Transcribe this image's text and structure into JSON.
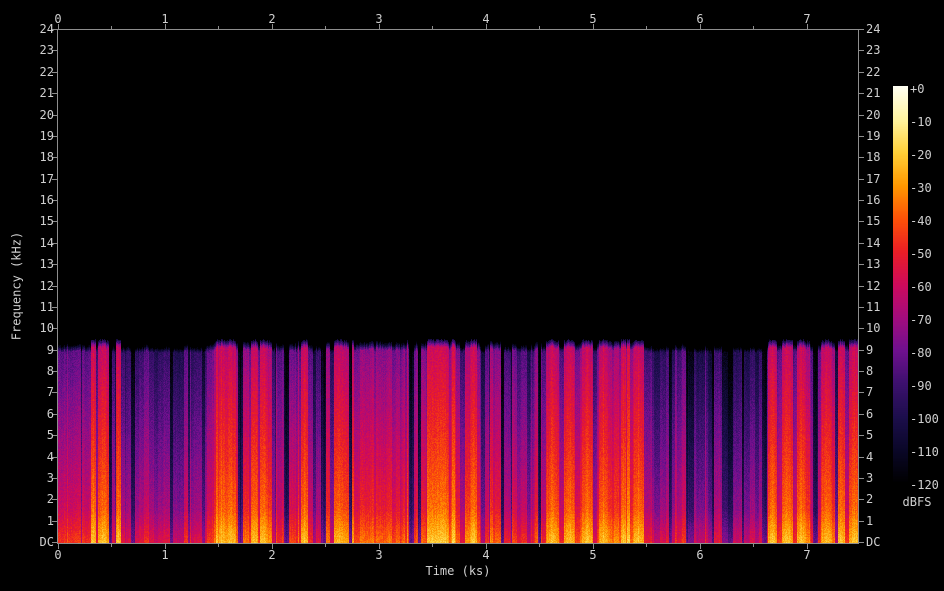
{
  "figure": {
    "background": "#000000",
    "axis_color": "#8e8e8e",
    "text_color": "#d0d0d0"
  },
  "axes": {
    "left": {
      "label": "Frequency (kHz)",
      "ticks": [
        "24",
        "23",
        "22",
        "21",
        "20",
        "19",
        "18",
        "17",
        "16",
        "15",
        "14",
        "13",
        "12",
        "11",
        "10",
        "9",
        "8",
        "7",
        "6",
        "5",
        "4",
        "3",
        "2",
        "1",
        "DC"
      ]
    },
    "right": {
      "ticks": [
        "24",
        "23",
        "22",
        "21",
        "20",
        "19",
        "18",
        "17",
        "16",
        "15",
        "14",
        "13",
        "12",
        "11",
        "10",
        "9",
        "8",
        "7",
        "6",
        "5",
        "4",
        "3",
        "2",
        "1",
        "DC"
      ]
    },
    "top": {
      "ticks": [
        "0",
        "1",
        "2",
        "3",
        "4",
        "5",
        "6",
        "7"
      ]
    },
    "bottom": {
      "label": "Time (ks)",
      "ticks": [
        "0",
        "1",
        "2",
        "3",
        "4",
        "5",
        "6",
        "7"
      ]
    }
  },
  "colorbar": {
    "unit": "dBFS",
    "ticks": [
      "+0",
      "-10",
      "-20",
      "-30",
      "-40",
      "-50",
      "-60",
      "-70",
      "-80",
      "-90",
      "-100",
      "-110",
      "-120"
    ]
  },
  "chart_data": {
    "type": "heatmap",
    "title": "",
    "xlabel": "Time (ks)",
    "ylabel": "Frequency (kHz)",
    "x_range_ks": [
      0,
      7.48
    ],
    "y_range_khz": [
      0,
      24
    ],
    "colorbar_label": "dBFS",
    "colorbar_range_dbfs": [
      0,
      -120
    ],
    "content_cutoff_khz": 9.3,
    "spectral_slope_db_per_khz": 3.2,
    "low_freq_boost_db": 10,
    "base_level_dbfs": -54,
    "noise_db": 8,
    "seed": 1337,
    "palette_stops": [
      [
        -120,
        0,
        0,
        0
      ],
      [
        -110,
        10,
        7,
        40
      ],
      [
        -100,
        28,
        14,
        76
      ],
      [
        -90,
        60,
        16,
        110
      ],
      [
        -80,
        110,
        16,
        142
      ],
      [
        -70,
        162,
        12,
        126
      ],
      [
        -60,
        205,
        10,
        92
      ],
      [
        -50,
        234,
        30,
        38
      ],
      [
        -40,
        252,
        82,
        8
      ],
      [
        -30,
        255,
        152,
        0
      ],
      [
        -20,
        255,
        208,
        56
      ],
      [
        -10,
        255,
        244,
        160
      ],
      [
        0,
        255,
        255,
        242
      ]
    ],
    "bright_zones_ks": [
      [
        0.08,
        0.62
      ],
      [
        1.45,
        2.0
      ],
      [
        3.45,
        3.72
      ],
      [
        4.45,
        5.45
      ],
      [
        6.6,
        7.48
      ]
    ],
    "dark_zones_ks": [
      [
        2.02,
        2.45
      ],
      [
        2.95,
        3.45
      ],
      [
        3.9,
        4.42
      ],
      [
        5.55,
        6.0
      ],
      [
        6.05,
        6.55
      ]
    ],
    "burst_times_ks": [
      0.33,
      0.42,
      0.56,
      1.52,
      1.62,
      1.83,
      1.92,
      2.3,
      2.62,
      3.52,
      3.62,
      3.88,
      4.62,
      4.78,
      4.95,
      5.1,
      5.28,
      5.42,
      6.68,
      6.82,
      6.95,
      7.18,
      7.32,
      7.44
    ],
    "gap_times_ks": [
      0.48,
      1.06,
      1.7,
      2.13,
      2.48,
      2.73,
      3.3,
      3.38,
      4.15,
      4.5,
      5.72,
      5.88,
      6.6,
      7.08
    ]
  }
}
